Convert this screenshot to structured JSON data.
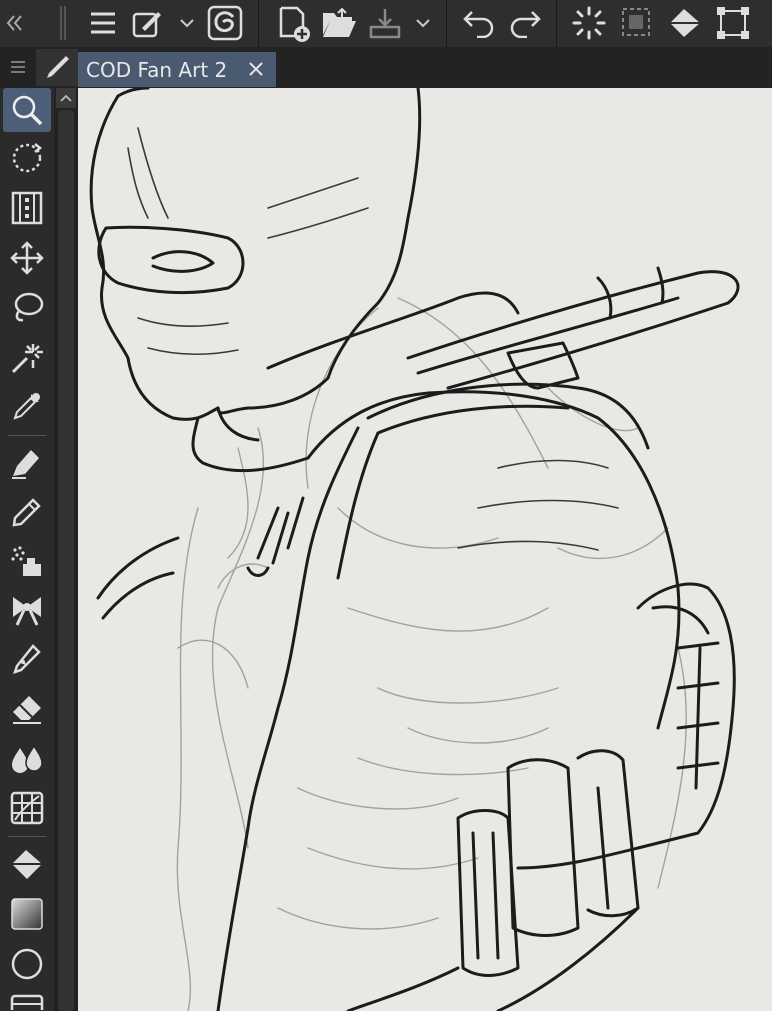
{
  "document_tab": {
    "title": "COD Fan Art 2",
    "close_icon": "close-icon"
  },
  "top_toolbar": {
    "items": [
      "collapse-panels-icon",
      "main-menu-icon",
      "quick-access-icon",
      "dropdown-icon",
      "app-logo-icon",
      "new-file-icon",
      "open-file-icon",
      "save-icon",
      "dropdown-icon",
      "undo-icon",
      "redo-icon",
      "loading-icon",
      "deselect-icon",
      "fill-icon",
      "transform-icon"
    ]
  },
  "tools": [
    {
      "name": "zoom-tool",
      "icon": "magnifier-icon",
      "active": true
    },
    {
      "name": "rotate-tool",
      "icon": "rotate-icon"
    },
    {
      "name": "frame-tool",
      "icon": "filmstrip-icon"
    },
    {
      "name": "move-tool",
      "icon": "move-arrows-icon"
    },
    {
      "name": "lasso-tool",
      "icon": "lasso-icon"
    },
    {
      "name": "auto-select-tool",
      "icon": "magic-wand-icon"
    },
    {
      "name": "eyedropper-tool",
      "icon": "eyedropper-icon"
    },
    {
      "name": "pen-tool",
      "icon": "pen-nib-icon"
    },
    {
      "name": "pencil-tool",
      "icon": "pencil-icon"
    },
    {
      "name": "airbrush-tool",
      "icon": "airbrush-icon"
    },
    {
      "name": "decoration-tool",
      "icon": "ribbon-icon"
    },
    {
      "name": "vector-pen-tool",
      "icon": "fountain-pen-icon"
    },
    {
      "name": "eraser-tool",
      "icon": "eraser-icon"
    },
    {
      "name": "blend-tool",
      "icon": "drops-icon"
    },
    {
      "name": "figure-tool",
      "icon": "grid-ruler-icon"
    },
    {
      "name": "fill-tool",
      "icon": "paint-bucket-icon"
    },
    {
      "name": "gradient-tool",
      "icon": "gradient-icon"
    },
    {
      "name": "shape-tool",
      "icon": "circle-icon"
    },
    {
      "name": "frame-border-tool",
      "icon": "panel-icon"
    }
  ],
  "panel_menu_icon": "hamburger-icon",
  "current_tool_icon": "pen-icon",
  "colors": {
    "active_tool_bg": "#4d5e78",
    "tab_bg": "#4a5a70",
    "canvas_paper": "#e9e8e5",
    "ink": "#1c1c1c"
  }
}
